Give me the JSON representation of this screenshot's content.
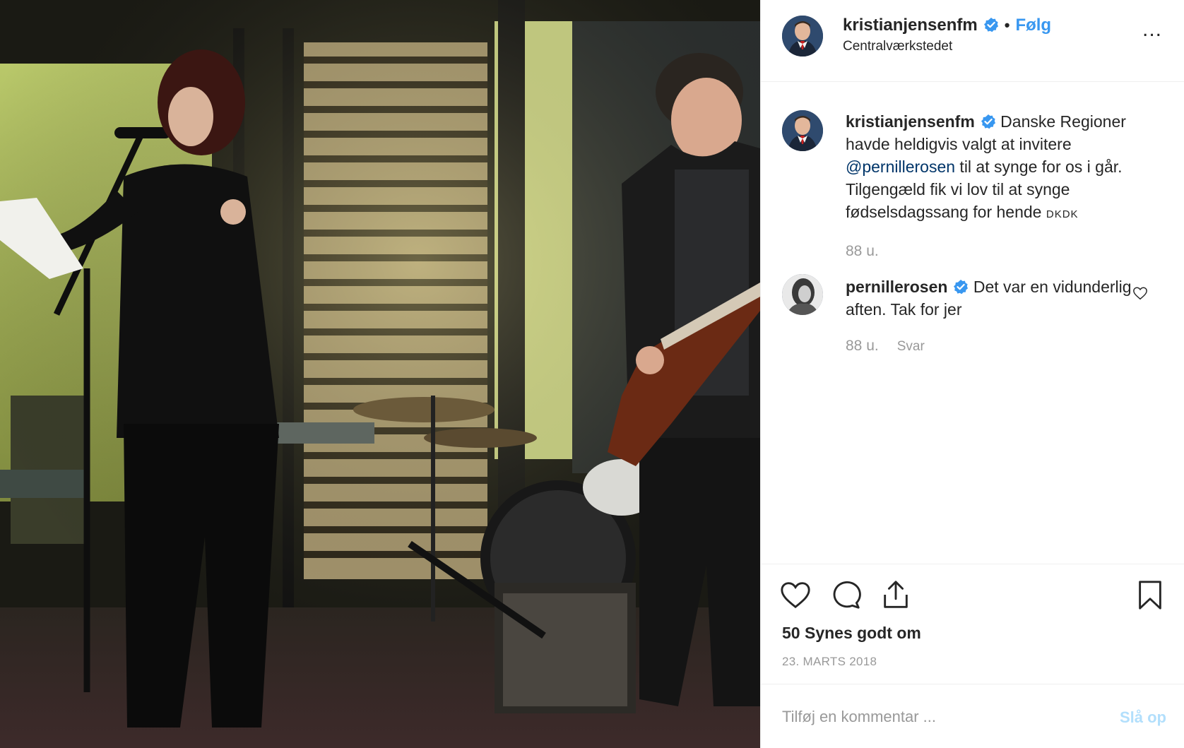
{
  "post": {
    "username": "kristianjensenfm",
    "location": "Centralværkstedet",
    "follow_label": "Følg",
    "separator": "•",
    "more_label": "...",
    "verified_color": "#3897f0"
  },
  "comments": [
    {
      "username": "kristianjensenfm",
      "text_before": " Danske Regioner havde heldigvis valgt at invitere ",
      "mention": "@pernillerosen",
      "text_after": " til at synge for os i går. Tilgengæld fik vi lov til at synge fødselsdagssang for hende ",
      "flags": "DKDK",
      "time": "88 u."
    },
    {
      "username": "pernillerosen",
      "text": " Det var en vidunderlig aften. Tak for jer",
      "time": "88 u.",
      "reply_label": "Svar"
    }
  ],
  "actions": {
    "likes": "50 Synes godt om",
    "date": "23. MARTS 2018"
  },
  "add_comment": {
    "placeholder": "Tilføj en kommentar ...",
    "post_label": "Slå op"
  },
  "colors": {
    "link": "#3897f0",
    "mention": "#003569",
    "muted": "#999999",
    "disabled_post": "#b2dffc"
  }
}
